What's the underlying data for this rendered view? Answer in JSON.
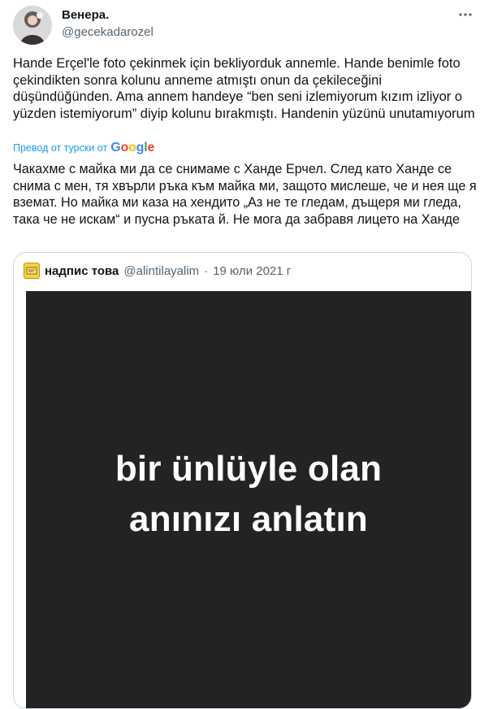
{
  "author": {
    "name": "Венера.",
    "handle": "@gecekadarozel"
  },
  "tweet": {
    "text": "Hande Erçel'le foto çekinmek için bekliyorduk annemle. Hande benimle foto çekindikten sonra kolunu anneme atmıştı onun da çekileceğini düşündüğünden. Ama annem handeye “ben seni izlemiyorum kızım izliyor o yüzden istemiyorum” diyip kolunu bırakmıştı. Handenin yüzünü unutamıyorum",
    "translate_label": "Превод от турски от",
    "translated_text": "Чакахме с майка ми да се снимаме с Ханде Ерчел. След като Ханде се снима с мен, тя хвърли ръка към майка ми, защото мислеше, че и нея ще я вземат. Но майка ми каза на хендито „Аз не те гледам, дъщеря ми гледа, така че не искам“ и пусна ръката й. Не мога да забравя лицето на Ханде"
  },
  "google_logo": {
    "letters": [
      "G",
      "o",
      "o",
      "g",
      "l",
      "e"
    ],
    "colors": [
      "#4285F4",
      "#EA4335",
      "#FBBC05",
      "#4285F4",
      "#34A853",
      "#EA4335"
    ]
  },
  "quote": {
    "name": "надпис това",
    "handle": "@alintilayalim",
    "dot": "·",
    "date": "19 юли 2021 г",
    "media_line1": "bir ünlüyle olan",
    "media_line2": "anınızı anlatın"
  },
  "colors": {
    "link": "#1d9bf0",
    "secondary_text": "#536471",
    "border": "#cfd9de",
    "media_background": "#232323"
  },
  "icons": {
    "more": "three-dots-icon",
    "quote_avatar": "quote-avatar-icon"
  }
}
